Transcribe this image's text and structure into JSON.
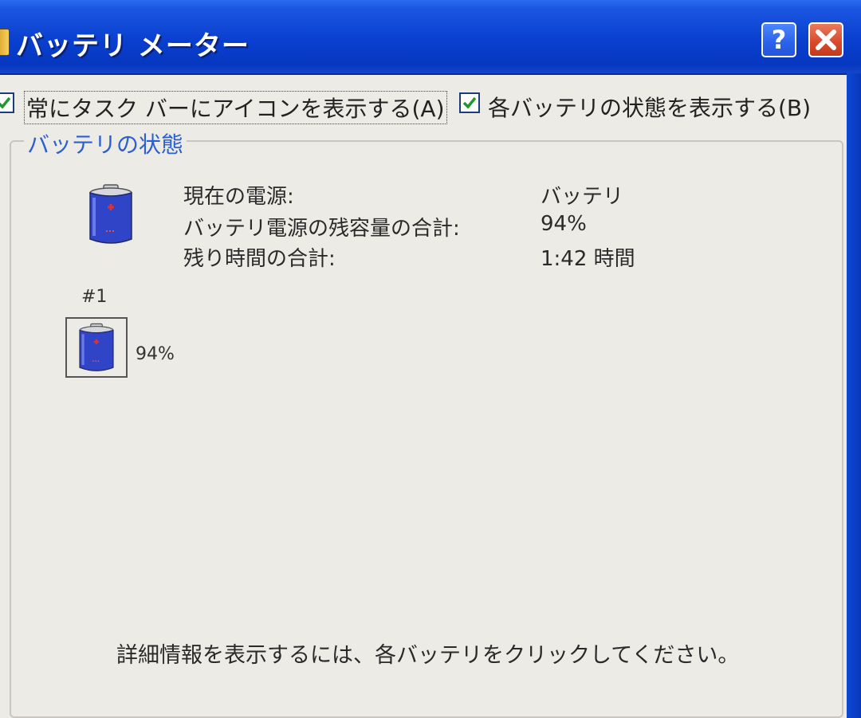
{
  "window": {
    "title": "バッテリ メーター",
    "help_button": "?",
    "close_button": "✕",
    "colors": {
      "titlebar": "#0a3fcf",
      "close": "#d8492a",
      "group_title": "#2c5fd0",
      "face": "#ecebe6"
    }
  },
  "options": {
    "always_show_icon": {
      "label": "常にタスク バーにアイコンを表示する(A)",
      "checked": true
    },
    "show_each_battery": {
      "label": "各バッテリの状態を表示する(B)",
      "checked": true
    }
  },
  "status_group": {
    "title": "バッテリの状態",
    "icon": "battery-icon",
    "rows": [
      {
        "label": "現在の電源:",
        "value": "バッテリ"
      },
      {
        "label": "バッテリ電源の残容量の合計:",
        "value": "94%"
      },
      {
        "label": "残り時間の合計:",
        "value": "1:42 時間"
      }
    ],
    "batteries": [
      {
        "number": "#1",
        "percent": "94%"
      }
    ],
    "hint": "詳細情報を表示するには、各バッテリをクリックしてください。"
  }
}
